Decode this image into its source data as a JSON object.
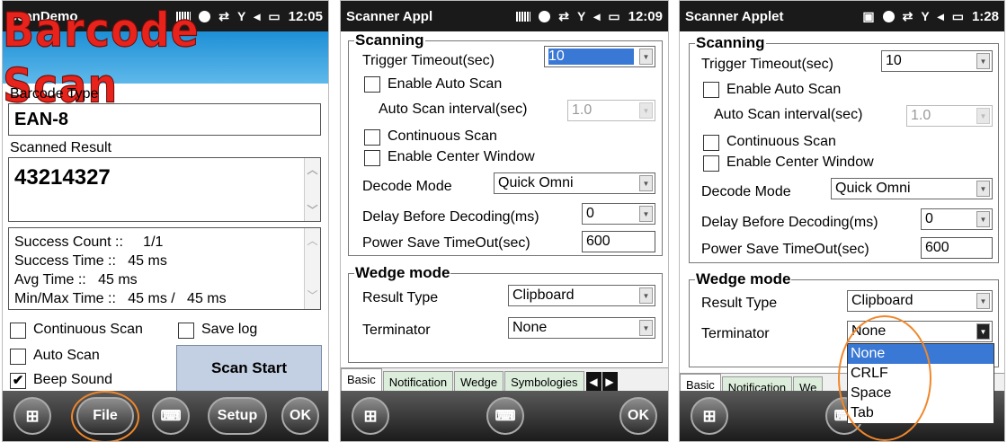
{
  "screen1": {
    "statusbar": {
      "title": "ScanDemo",
      "time": "12:05"
    },
    "banner": "Barcode Scan",
    "barcode_type_label": "Barcode Type",
    "barcode_type_value": "EAN-8",
    "scanned_result_label": "Scanned Result",
    "scanned_result_value": "43214327",
    "stats": {
      "success_count": "Success Count ::     1/1",
      "success_time": "Success Time ::   45 ms",
      "avg_time": "Avg Time ::   45 ms",
      "minmax_time": "Min/Max Time ::   45 ms /   45 ms"
    },
    "continuous_scan_label": "Continuous Scan",
    "save_log_label": "Save log",
    "auto_scan_label": "Auto Scan",
    "beep_sound_label": "Beep Sound",
    "beep_sound_check": "✔",
    "scan_start_label": "Scan Start",
    "bottom_bar": {
      "file": "File",
      "setup": "Setup",
      "ok": "OK"
    }
  },
  "screen2": {
    "statusbar": {
      "title": "Scanner Appl",
      "time": "12:09"
    },
    "scanning_group": "Scanning",
    "trigger_timeout_label": "Trigger Timeout(sec)",
    "trigger_timeout_value": "10",
    "enable_auto_scan_label": "Enable Auto Scan",
    "auto_scan_interval_label": "Auto Scan interval(sec)",
    "auto_scan_interval_value": "1.0",
    "continuous_scan_label": "Continuous Scan",
    "enable_center_window_label": "Enable Center Window",
    "decode_mode_label": "Decode Mode",
    "decode_mode_value": "Quick Omni",
    "delay_label": "Delay Before Decoding(ms)",
    "delay_value": "0",
    "power_save_label": "Power Save TimeOut(sec)",
    "power_save_value": "600",
    "wedge_group": "Wedge mode",
    "result_type_label": "Result Type",
    "result_type_value": "Clipboard",
    "terminator_label": "Terminator",
    "terminator_value": "None",
    "tabs": [
      "Basic",
      "Notification",
      "Wedge",
      "Symbologies"
    ],
    "ok_label": "OK"
  },
  "screen3": {
    "statusbar": {
      "title": "Scanner Applet",
      "time": "1:28"
    },
    "scanning_group": "Scanning",
    "trigger_timeout_label": "Trigger Timeout(sec)",
    "trigger_timeout_value": "10",
    "enable_auto_scan_label": "Enable Auto Scan",
    "auto_scan_interval_label": "Auto Scan interval(sec)",
    "auto_scan_interval_value": "1.0",
    "continuous_scan_label": "Continuous Scan",
    "enable_center_window_label": "Enable Center Window",
    "decode_mode_label": "Decode Mode",
    "decode_mode_value": "Quick Omni",
    "delay_label": "Delay Before Decoding(ms)",
    "delay_value": "0",
    "power_save_label": "Power Save TimeOut(sec)",
    "power_save_value": "600",
    "wedge_group": "Wedge mode",
    "result_type_label": "Result Type",
    "result_type_value": "Clipboard",
    "terminator_label": "Terminator",
    "terminator_value": "None",
    "terminator_options": [
      "None",
      "CRLF",
      "Space",
      "Tab"
    ],
    "tabs": [
      "Basic",
      "Notification",
      "We"
    ]
  },
  "colors": {
    "accent": "#3978d4",
    "highlight_circle": "#f0872b",
    "banner_red": "#e8231c",
    "banner_blue": "#1d8fd6"
  }
}
